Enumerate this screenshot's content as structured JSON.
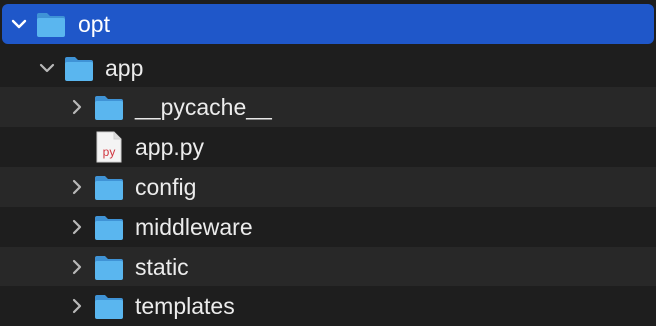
{
  "tree": {
    "items": [
      {
        "label": "opt",
        "type": "folder",
        "expanded": true,
        "selected": true,
        "level": 0
      },
      {
        "label": "app",
        "type": "folder",
        "expanded": true,
        "selected": false,
        "level": 1
      },
      {
        "label": "__pycache__",
        "type": "folder",
        "expanded": false,
        "selected": false,
        "level": 2
      },
      {
        "label": "app.py",
        "type": "file",
        "badge": "py",
        "selected": false,
        "level": 2
      },
      {
        "label": "config",
        "type": "folder",
        "expanded": false,
        "selected": false,
        "level": 2
      },
      {
        "label": "middleware",
        "type": "folder",
        "expanded": false,
        "selected": false,
        "level": 2
      },
      {
        "label": "static",
        "type": "folder",
        "expanded": false,
        "selected": false,
        "level": 2
      },
      {
        "label": "templates",
        "type": "folder",
        "expanded": false,
        "selected": false,
        "level": 2
      }
    ]
  },
  "colors": {
    "selection": "#1f57c9",
    "folder": "#5ab6ef",
    "py_badge": "#d0353f"
  }
}
